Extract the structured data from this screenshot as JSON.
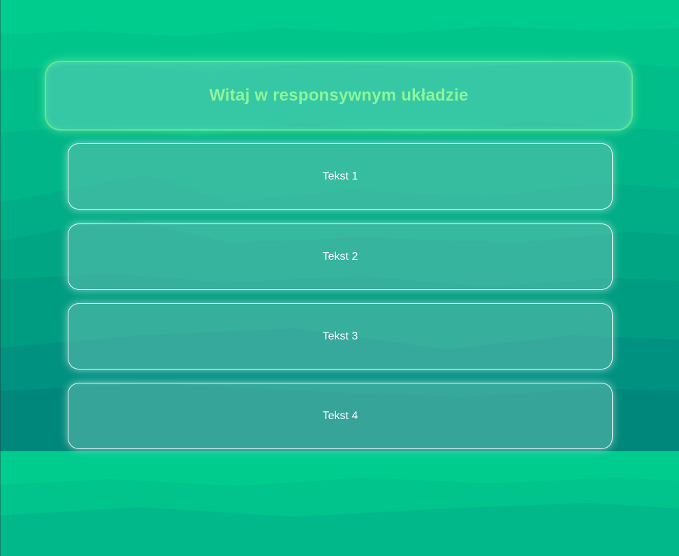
{
  "header": {
    "title": "Witaj w responsywnym układzie"
  },
  "cards": [
    {
      "label": "Tekst 1"
    },
    {
      "label": "Tekst 2"
    },
    {
      "label": "Tekst 3"
    },
    {
      "label": "Tekst 4"
    }
  ],
  "colors": {
    "background_top": "#00cc8e",
    "background_bottom": "#008478",
    "footer": "#00bf8c",
    "title": "#8ef59c",
    "card_border": "#ffffff"
  }
}
